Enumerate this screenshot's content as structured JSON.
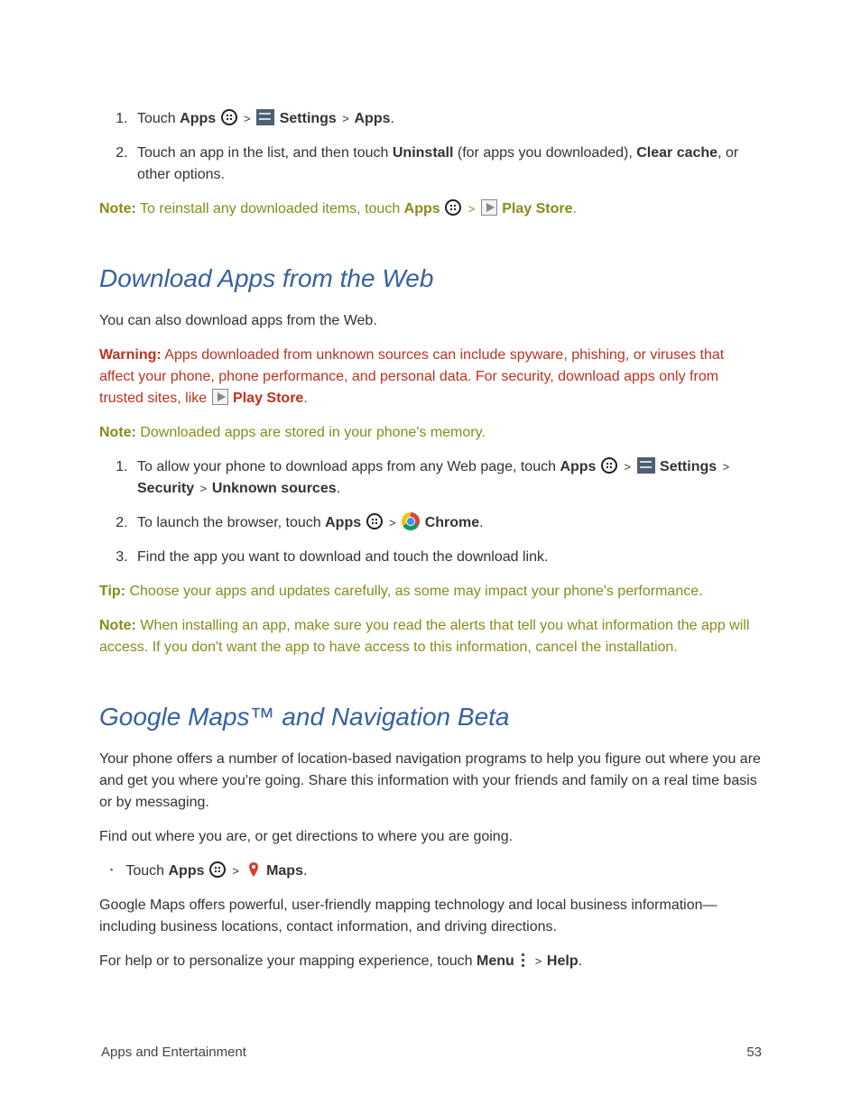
{
  "list1": {
    "item1": {
      "touch": "Touch ",
      "apps": "Apps",
      "settings": " Settings",
      "apps2": "Apps",
      "dot": "."
    },
    "item2": {
      "prefix": "Touch an app in the list, and then touch ",
      "uninstall": "Uninstall",
      "mid": " (for apps you downloaded), ",
      "clear": "Clear cache",
      "rest": ", or other options."
    }
  },
  "note1": {
    "label": "Note:",
    "text1": " To reinstall any downloaded items, touch ",
    "apps": "Apps",
    "play": " Play Store",
    "dot": "."
  },
  "section1": {
    "heading": "Download Apps from the Web",
    "intro": "You can also download apps from the Web.",
    "warning": {
      "label": "Warning:",
      "body": " Apps downloaded from unknown sources can include spyware, phishing, or viruses that affect your phone, phone performance, and personal data. For security, download apps only from trusted sites, like ",
      "play": " Play Store",
      "dot": "."
    },
    "note2": {
      "label": "Note:",
      "text": " Downloaded apps are stored in your phone's memory."
    },
    "list": {
      "item1": {
        "pre": "To allow your phone to download apps from any Web page, touch ",
        "apps": "Apps",
        "settings": " Settings",
        "security": "Security ",
        "unknown": "Unknown sources",
        "dot": "."
      },
      "item2": {
        "pre": "To launch the browser, touch ",
        "apps": "Apps",
        "chrome": " Chrome",
        "dot": "."
      },
      "item3": "Find the app you want to download and touch the download link."
    },
    "tip": {
      "label": "Tip:",
      "text": "  Choose your apps and updates carefully, as some may impact your phone's performance."
    },
    "note3": {
      "label": "Note:",
      "text": "  When installing an app, make sure you read the alerts that tell you what information the app will access. If you don't want the app to have access to this information, cancel the installation."
    }
  },
  "section2": {
    "heading": "Google Maps™ and Navigation Beta",
    "p1": "Your phone offers a number of location-based navigation programs to help you figure out where you are and get you where you're going. Share this information with your friends and family on a real time basis or by messaging.",
    "p2": "Find out where you are, or get directions to where you are going.",
    "bullet": {
      "touch": "Touch ",
      "apps": "Apps",
      "maps": " Maps",
      "dot": "."
    },
    "p3": "Google Maps offers powerful, user-friendly mapping technology and local business information—including business locations, contact information, and driving directions.",
    "p4": {
      "pre": "For help or to personalize your mapping experience, touch ",
      "menu": "Menu",
      "help": "Help",
      "dot": "."
    }
  },
  "footer": {
    "left": "Apps and Entertainment",
    "right": "53"
  },
  "sep": " > "
}
